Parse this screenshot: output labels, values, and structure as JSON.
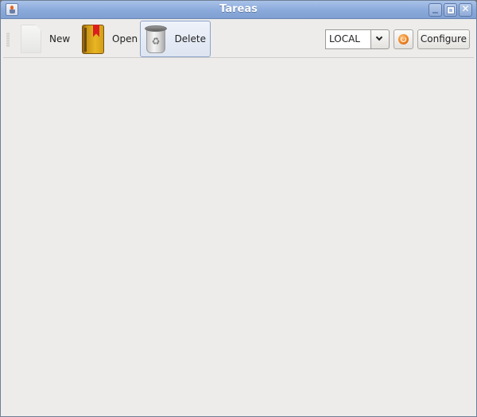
{
  "window": {
    "title": "Tareas",
    "app_icon": "java-cup-icon",
    "controls": [
      {
        "name": "minimize",
        "icon": "minimize-icon"
      },
      {
        "name": "maximize",
        "icon": "maximize-icon"
      },
      {
        "name": "close",
        "icon": "close-icon",
        "glyph": "✕"
      }
    ]
  },
  "toolbar": {
    "new_label": "New",
    "new_icon": "blank-document-icon",
    "open_label": "Open",
    "open_icon": "book-icon",
    "delete_label": "Delete",
    "delete_icon": "trash-can-icon",
    "recycle_glyph": "♻",
    "source_combo": {
      "selected": "LOCAL"
    },
    "refresh_icon": "refresh-orb-icon",
    "configure_label": "Configure"
  },
  "colors": {
    "titlebar": "#8cabdc",
    "background": "#edecea",
    "active_button_border": "#8da3c9"
  }
}
